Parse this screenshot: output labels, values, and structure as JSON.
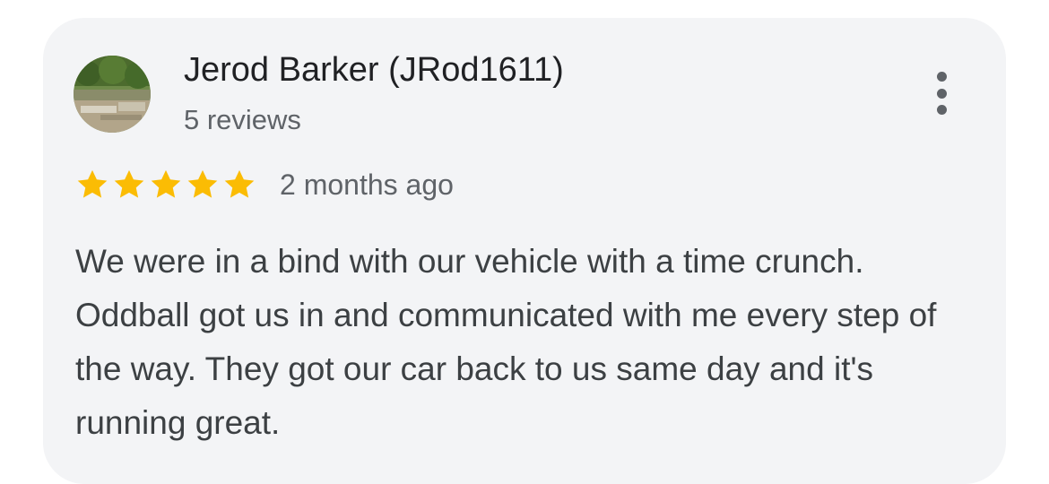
{
  "review": {
    "author_name": "Jerod Barker (JRod1611)",
    "author_reviews": "5 reviews",
    "rating": 5,
    "rating_max": 5,
    "date": "2 months ago",
    "text": "We were in a bind with our vehicle with a time crunch. Oddball got us in and communicated with me every step of the way. They got our car back to us same day and it's running great.",
    "more_icon": "more-vert-icon",
    "star_icon": "star-icon"
  },
  "colors": {
    "card_background": "#f3f4f6",
    "star": "#fbbc04",
    "primary_text": "#202124",
    "secondary_text": "#5f6368",
    "body_text": "#3c4043"
  }
}
